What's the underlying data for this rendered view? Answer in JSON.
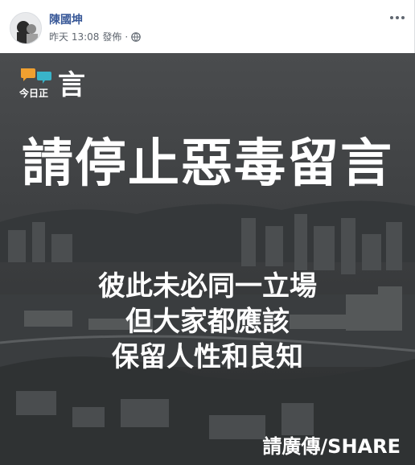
{
  "post": {
    "author": "陳國坤",
    "timestamp": "昨天 13:08",
    "action": "發佈",
    "privacy_icon": "globe-icon",
    "more_icon": "more-options-icon"
  },
  "image": {
    "logo": {
      "small_text": "今日正",
      "big_text": "言"
    },
    "headline": "請停止惡毒留言",
    "lines": [
      "彼此未必同一立場",
      "但大家都應該",
      "保留人性和良知"
    ],
    "share": "請廣傳/SHARE"
  },
  "colors": {
    "author_link": "#385898",
    "meta_text": "#606770",
    "logo_orange": "#f0a030",
    "logo_teal": "#39b4c9"
  }
}
